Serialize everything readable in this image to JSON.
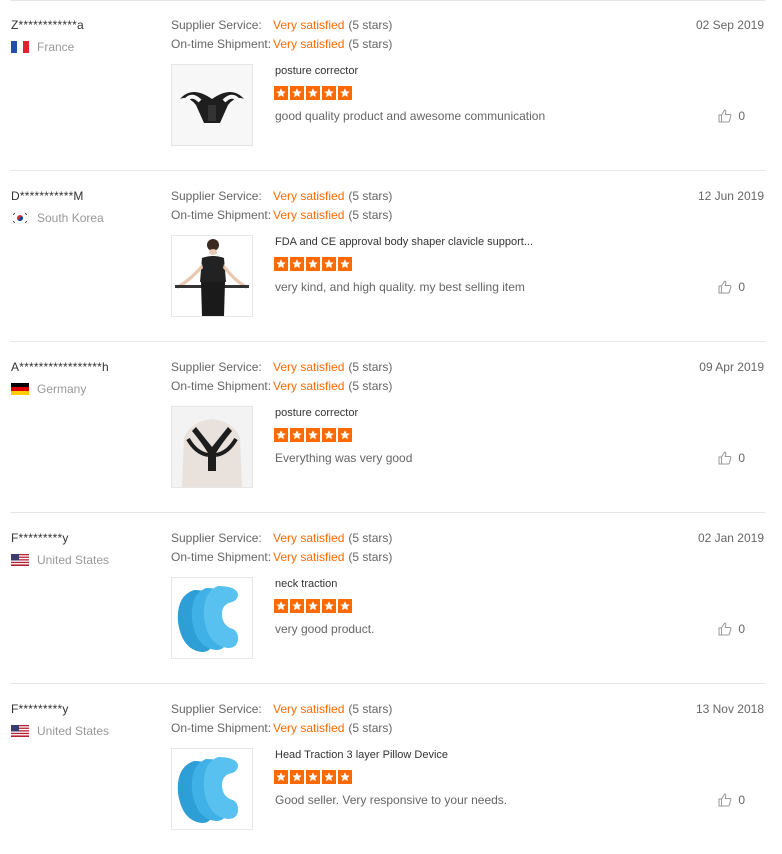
{
  "colors": {
    "accent": "#ff6a00",
    "divider": "#e6e6e6",
    "muted": "#999999"
  },
  "reviews": [
    {
      "buyer": "Z************a",
      "country": "France",
      "flag_icon": "france-flag-icon",
      "supplier_label": "Supplier Service:",
      "supplier_value": "Very satisfied",
      "supplier_stars": "(5 stars)",
      "shipment_label": "On-time Shipment:",
      "shipment_value": "Very satisfied",
      "shipment_stars": "(5 stars)",
      "date": "02 Sep 2019",
      "product": "posture corrector",
      "product_icon": "posture-corrector-image",
      "rating": 5,
      "comment": "good quality product and awesome communication",
      "likes": "0"
    },
    {
      "buyer": "D***********M",
      "country": "South Korea",
      "flag_icon": "south-korea-flag-icon",
      "supplier_label": "Supplier Service:",
      "supplier_value": "Very satisfied",
      "supplier_stars": "(5 stars)",
      "shipment_label": "On-time Shipment:",
      "shipment_value": "Very satisfied",
      "shipment_stars": "(5 stars)",
      "date": "12 Jun 2019",
      "product": "FDA and CE approval body shaper clavicle support...",
      "product_icon": "body-shaper-image",
      "rating": 5,
      "comment": "very kind, and high quality. my best selling item",
      "likes": "0"
    },
    {
      "buyer": "A*****************h",
      "country": "Germany",
      "flag_icon": "germany-flag-icon",
      "supplier_label": "Supplier Service:",
      "supplier_value": "Very satisfied",
      "supplier_stars": "(5 stars)",
      "shipment_label": "On-time Shipment:",
      "shipment_value": "Very satisfied",
      "shipment_stars": "(5 stars)",
      "date": "09 Apr 2019",
      "product": "posture corrector",
      "product_icon": "posture-corrector-back-image",
      "rating": 5,
      "comment": "Everything was very good",
      "likes": "0"
    },
    {
      "buyer": "F*********y",
      "country": "United States",
      "flag_icon": "usa-flag-icon",
      "supplier_label": "Supplier Service:",
      "supplier_value": "Very satisfied",
      "supplier_stars": "(5 stars)",
      "shipment_label": "On-time Shipment:",
      "shipment_value": "Very satisfied",
      "shipment_stars": "(5 stars)",
      "date": "02 Jan 2019",
      "product": "neck traction",
      "product_icon": "neck-pillow-image",
      "rating": 5,
      "comment": "very good product.",
      "likes": "0"
    },
    {
      "buyer": "F*********y",
      "country": "United States",
      "flag_icon": "usa-flag-icon",
      "supplier_label": "Supplier Service:",
      "supplier_value": "Very satisfied",
      "supplier_stars": "(5 stars)",
      "shipment_label": "On-time Shipment:",
      "shipment_value": "Very satisfied",
      "shipment_stars": "(5 stars)",
      "date": "13 Nov 2018",
      "product": "Head Traction 3 layer Pillow Device",
      "product_icon": "neck-pillow-image",
      "rating": 5,
      "comment": "Good seller. Very responsive to your needs.",
      "likes": "0"
    }
  ]
}
